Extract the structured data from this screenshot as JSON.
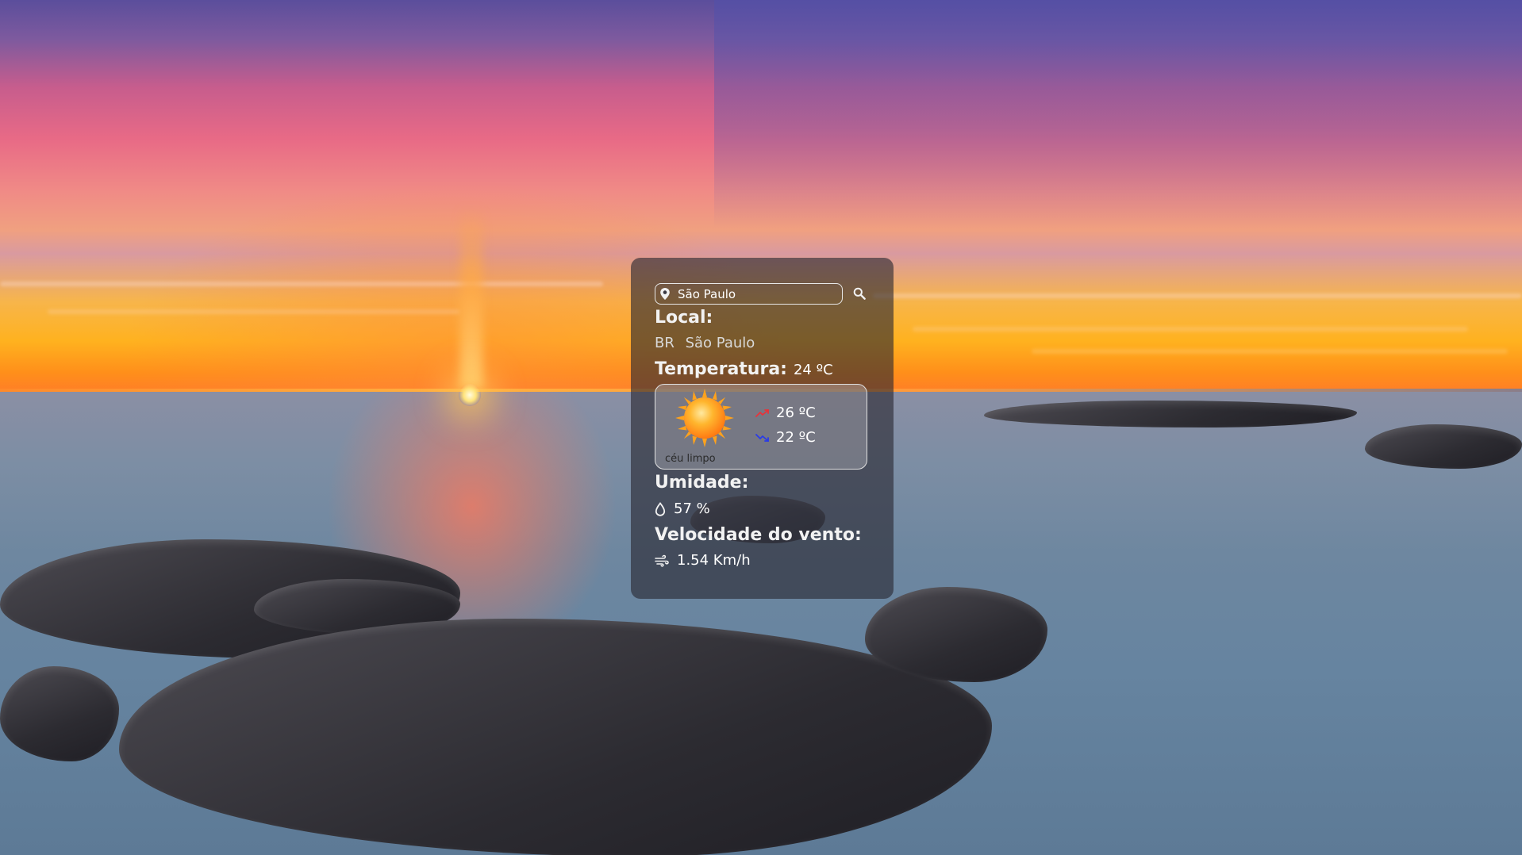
{
  "search": {
    "value": "São Paulo",
    "placeholder": ""
  },
  "labels": {
    "local": "Local:",
    "temperatura": "Temperatura:",
    "umidade": "Umidade:",
    "velocidade": "Velocidade do vento:"
  },
  "location": {
    "country": "BR",
    "city": "São Paulo"
  },
  "weather": {
    "temperature": "24 ºC",
    "description": "céu limpo",
    "max": "26 ºC",
    "min": "22 ºC",
    "humidity": "57 %",
    "wind_speed": "1.54 Km/h",
    "condition_icon": "sun-icon"
  },
  "icons": {
    "search_location": "map-pin-icon",
    "search_button": "magnifier-icon",
    "max_temp": "trend-up-icon",
    "min_temp": "trend-down-icon",
    "humidity": "droplet-icon",
    "wind": "wind-icon"
  },
  "colors": {
    "max_trend": "#e8333a",
    "min_trend": "#2a3be8",
    "card_bg": "#28263099"
  }
}
